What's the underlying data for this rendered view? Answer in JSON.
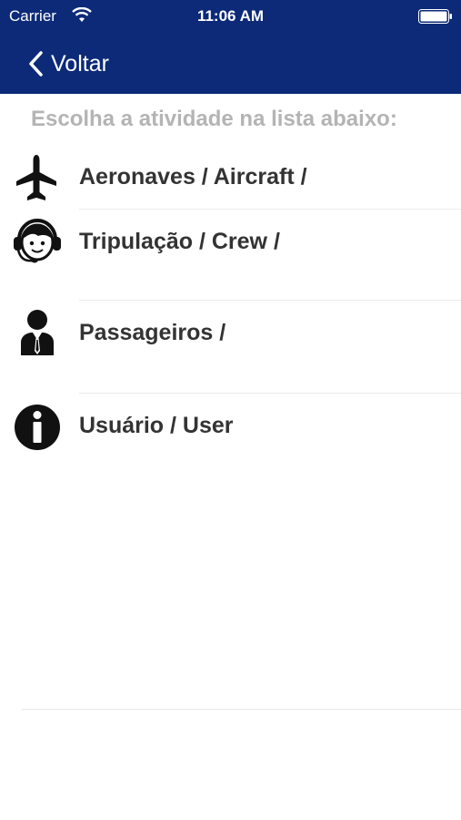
{
  "status_bar": {
    "carrier": "Carrier",
    "time": "11:06 AM",
    "wifi_icon": "wifi-icon",
    "battery_icon": "battery-icon"
  },
  "navbar": {
    "back_label": "Voltar",
    "back_icon": "chevron-left-icon",
    "background_color": "#0c2a78"
  },
  "instruction": "Escolha a atividade na lista abaixo:",
  "activities": [
    {
      "label": "Aeronaves / Aircraft /",
      "icon": "airplane-icon"
    },
    {
      "label": "Tripulação / Crew /",
      "icon": "crew-headset-icon"
    },
    {
      "label": "Passageiros /",
      "icon": "passenger-icon"
    },
    {
      "label": "Usuário / User",
      "icon": "info-icon"
    }
  ]
}
